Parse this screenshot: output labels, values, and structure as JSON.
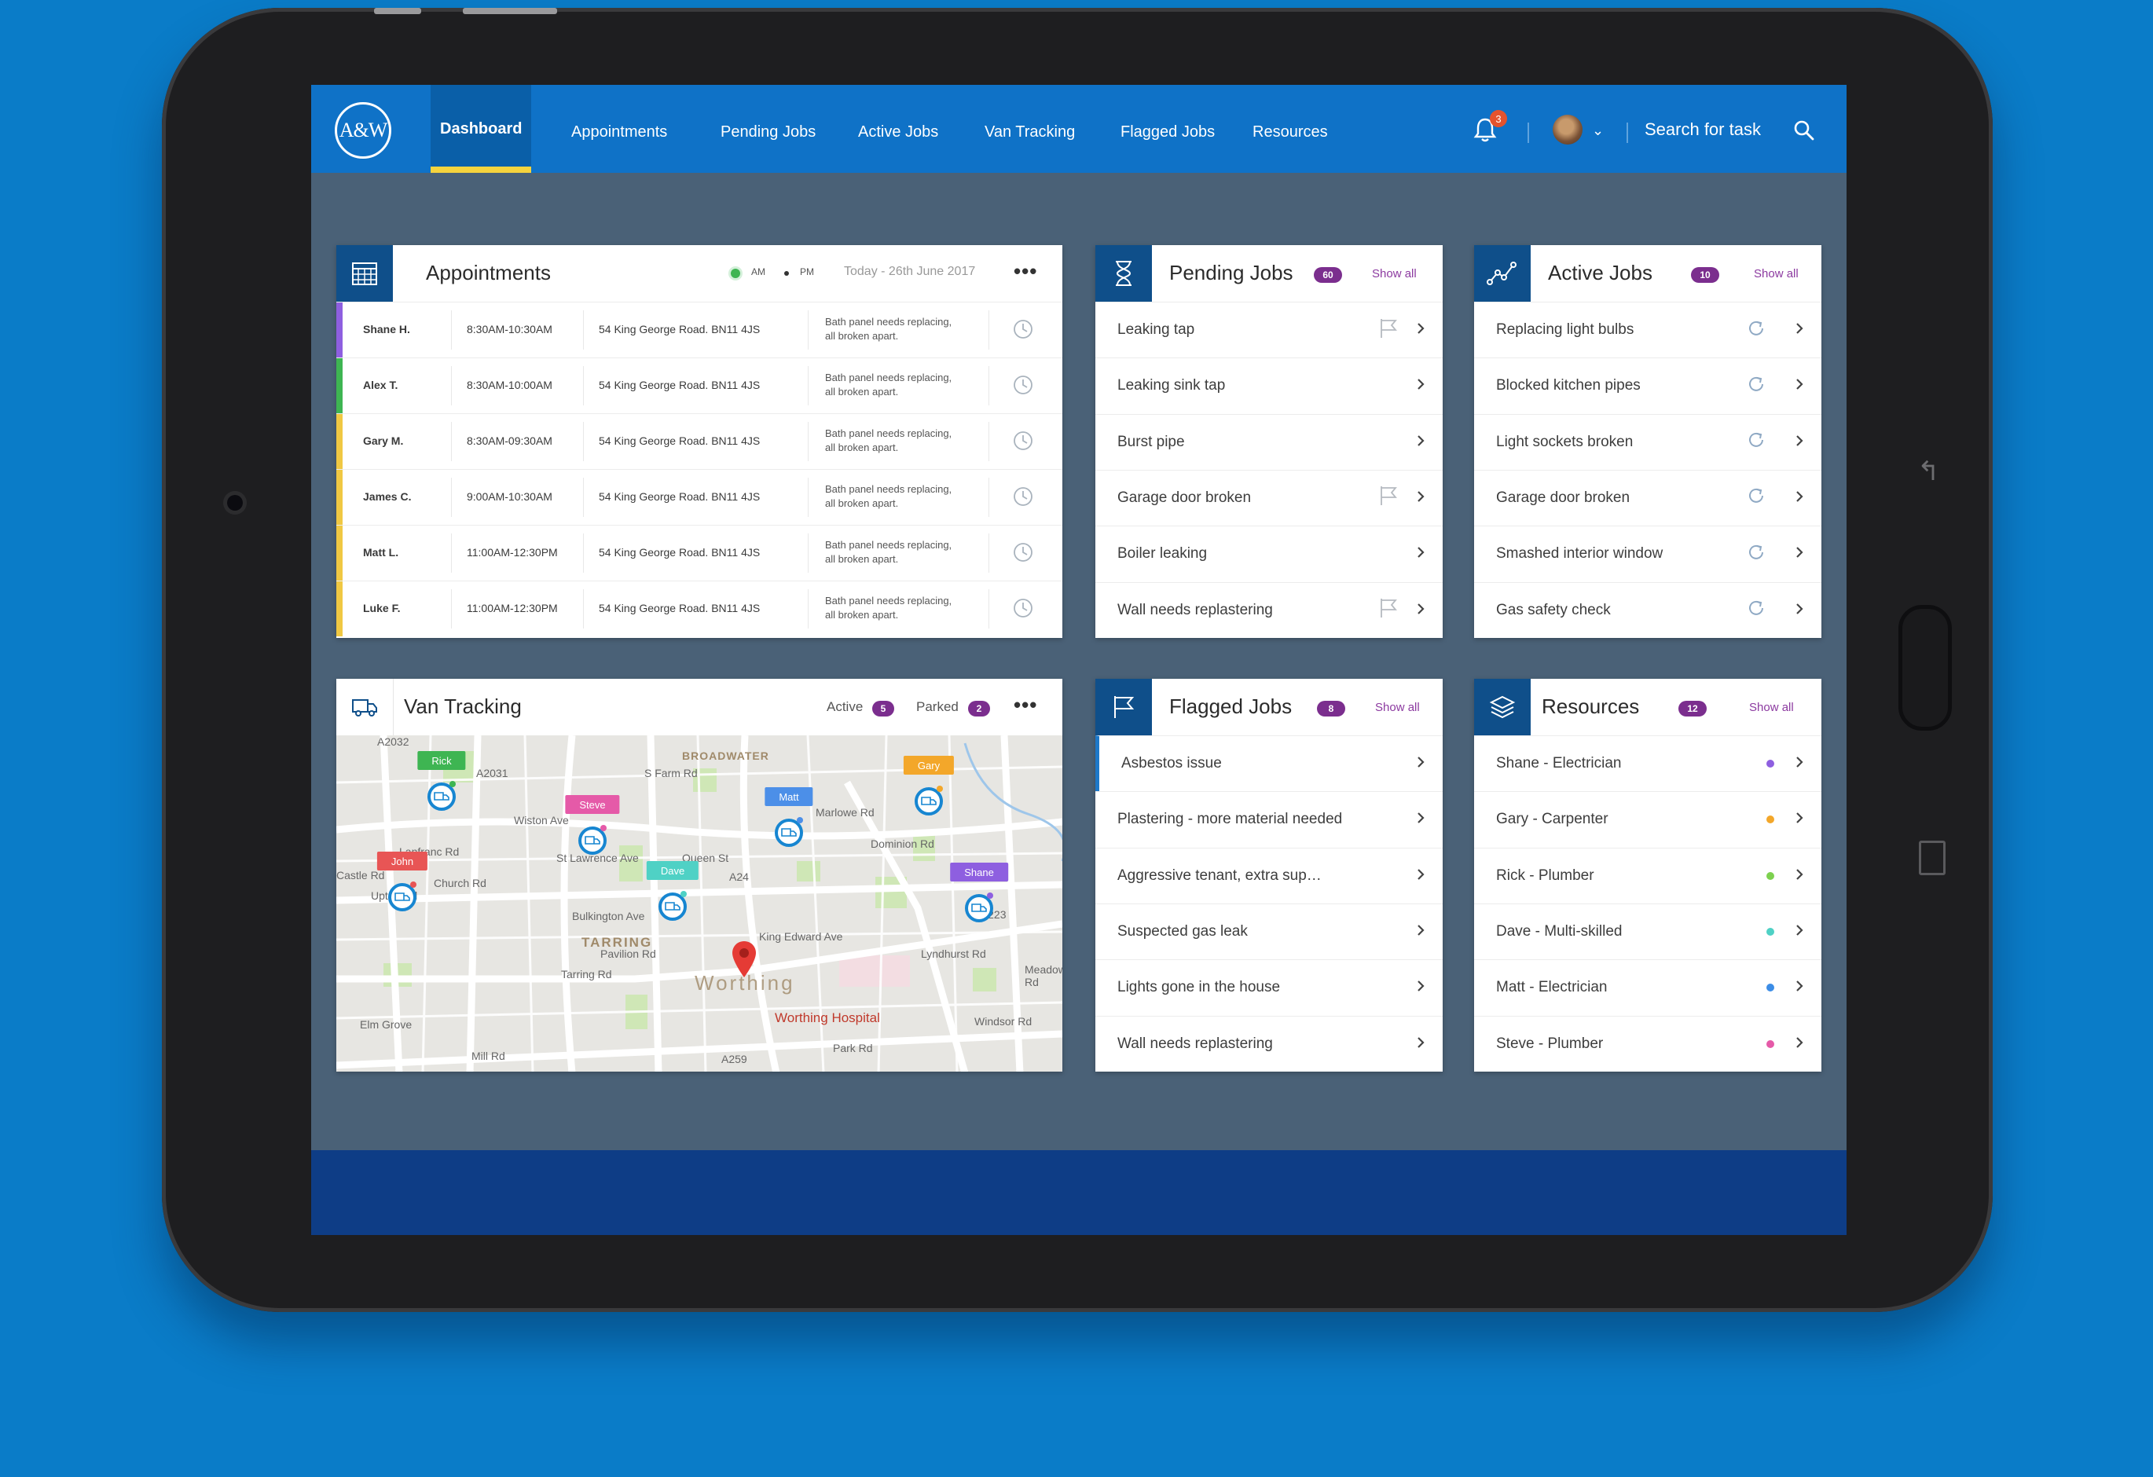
{
  "nav": {
    "logo": "A&W",
    "items": [
      "Dashboard",
      "Appointments",
      "Pending Jobs",
      "Active Jobs",
      "Van Tracking",
      "Flagged Jobs",
      "Resources"
    ],
    "notification_count": "3",
    "search_placeholder": "Search for task"
  },
  "appointments": {
    "title": "Appointments",
    "legend_am": "AM",
    "legend_pm": "PM",
    "date": "Today - 26th June 2017",
    "rows": [
      {
        "name": "Shane H.",
        "time": "8:30AM-10:30AM",
        "address": "54 King George Road. BN11 4JS",
        "note": "Bath panel needs replacing, all broken apart.",
        "color": "#8e5fe0"
      },
      {
        "name": "Alex T.",
        "time": "8:30AM-10:00AM",
        "address": "54 King George Road. BN11 4JS",
        "note": "Bath panel needs replacing, all broken apart.",
        "color": "#3eb552"
      },
      {
        "name": "Gary M.",
        "time": "8:30AM-09:30AM",
        "address": "54 King George Road. BN11 4JS",
        "note": "Bath panel needs replacing, all broken apart.",
        "color": "#f0c843"
      },
      {
        "name": "James C.",
        "time": "9:00AM-10:30AM",
        "address": "54 King George Road. BN11 4JS",
        "note": "Bath panel needs replacing, all broken apart.",
        "color": "#f0c843"
      },
      {
        "name": "Matt L.",
        "time": "11:00AM-12:30PM",
        "address": "54 King George Road. BN11 4JS",
        "note": "Bath panel needs replacing, all broken apart.",
        "color": "#f0c843"
      },
      {
        "name": "Luke F.",
        "time": "11:00AM-12:30PM",
        "address": "54 King George Road. BN11 4JS",
        "note": "Bath panel needs replacing, all broken apart.",
        "color": "#f0c843"
      }
    ]
  },
  "pending": {
    "title": "Pending Jobs",
    "count": "60",
    "show_all": "Show all",
    "items": [
      {
        "label": "Leaking tap",
        "flag": true
      },
      {
        "label": "Leaking sink tap",
        "flag": false
      },
      {
        "label": "Burst pipe",
        "flag": false
      },
      {
        "label": "Garage door broken",
        "flag": true
      },
      {
        "label": "Boiler leaking",
        "flag": false
      },
      {
        "label": "Wall needs replastering",
        "flag": true
      }
    ]
  },
  "active": {
    "title": "Active Jobs",
    "count": "10",
    "show_all": "Show all",
    "items": [
      "Replacing light bulbs",
      "Blocked kitchen pipes",
      "Light sockets broken",
      "Garage door broken",
      "Smashed interior window",
      "Gas safety check"
    ]
  },
  "van": {
    "title": "Van Tracking",
    "active_label": "Active",
    "active_count": "5",
    "parked_label": "Parked",
    "parked_count": "2",
    "vans": [
      {
        "name": "Rick",
        "color": "#3eb552"
      },
      {
        "name": "Steve",
        "color": "#e55aa8"
      },
      {
        "name": "Matt",
        "color": "#4c8fe8"
      },
      {
        "name": "Gary",
        "color": "#f3a72a"
      },
      {
        "name": "John",
        "color": "#e85555"
      },
      {
        "name": "Dave",
        "color": "#4fd1c5"
      },
      {
        "name": "Shane",
        "color": "#8e5fe0"
      }
    ],
    "map_labels": [
      "BROADWATER",
      "TARRING",
      "Worthing",
      "Worthing Hospital",
      "King Edward Ave",
      "Wiston Ave",
      "Tarring Rd",
      "Mill Rd",
      "A259",
      "A24",
      "A2032",
      "Bulkington Ave",
      "Queen St",
      "Pavilion Rd",
      "Dominion Rd",
      "Marlowe Rd",
      "Church Rd",
      "Upton Rd",
      "St Lawrence Ave",
      "Lyndhurst Rd",
      "B2223",
      "Meadow Rd",
      "Elm Grove",
      "A2031",
      "S Farm Rd",
      "Castle Rd",
      "Lanfranc Rd",
      "Park Rd",
      "Windsor Rd"
    ]
  },
  "flagged": {
    "title": "Flagged Jobs",
    "count": "8",
    "show_all": "Show all",
    "items": [
      "Asbestos issue",
      "Plastering - more material needed",
      "Aggressive tenant, extra sup…",
      "Suspected gas leak",
      "Lights gone in the house",
      "Wall needs replastering"
    ]
  },
  "resources": {
    "title": "Resources",
    "count": "12",
    "show_all": "Show all",
    "items": [
      {
        "label": "Shane - Electrician",
        "color": "#8e5fe0"
      },
      {
        "label": "Gary - Carpenter",
        "color": "#f3a72a"
      },
      {
        "label": "Rick - Plumber",
        "color": "#7dd14f"
      },
      {
        "label": "Dave - Multi-skilled",
        "color": "#4fd1c5"
      },
      {
        "label": "Matt - Electrician",
        "color": "#3c8de6"
      },
      {
        "label": "Steve - Plumber",
        "color": "#e55aa8"
      }
    ]
  }
}
